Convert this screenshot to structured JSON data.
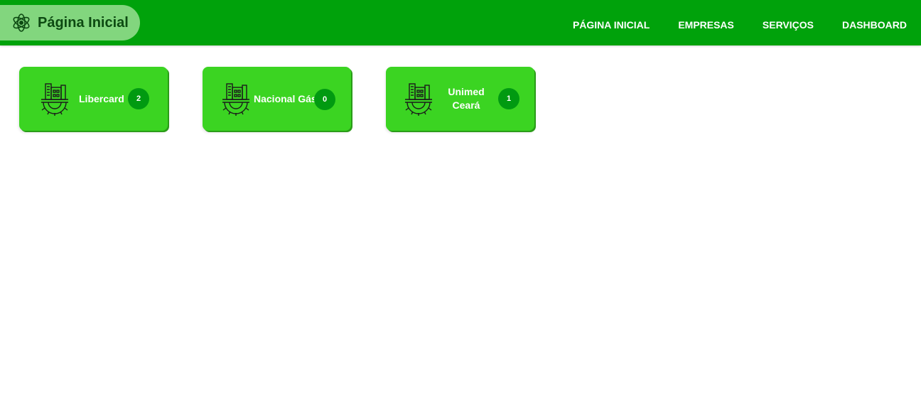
{
  "header": {
    "brand_icon": "atom-logo-icon",
    "title": "Página Inicial",
    "nav": [
      {
        "label": "PÁGINA INICIAL"
      },
      {
        "label": "EMPRESAS"
      },
      {
        "label": "SERVIÇOS"
      },
      {
        "label": "DASHBOARD"
      }
    ]
  },
  "companies": [
    {
      "name": "Libercard",
      "count": "2",
      "icon": "company-building-gear-icon"
    },
    {
      "name": "Nacional Gás",
      "count": "0",
      "icon": "company-building-gear-icon"
    },
    {
      "name_line1": "Unimed",
      "name_line2": "Ceará",
      "count": "1",
      "icon": "company-building-gear-icon"
    }
  ],
  "colors": {
    "header": "#00a20b",
    "brand_pill": "#82d67e",
    "card": "#3bd422",
    "badge": "#019a11"
  }
}
